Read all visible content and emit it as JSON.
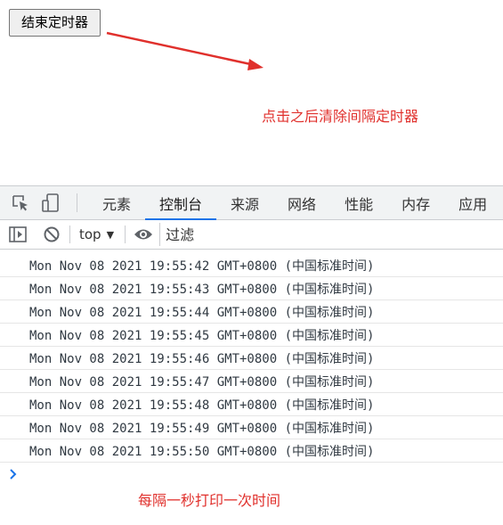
{
  "page": {
    "end_timer_button": "结束定时器",
    "annotation_top": "点击之后清除间隔定时器",
    "annotation_bottom": "每隔一秒打印一次时间",
    "annotation_color": "#e0302c"
  },
  "devtools": {
    "icons": [
      "inspect-element-icon",
      "device-toolbar-icon"
    ],
    "tabs": [
      {
        "label": "元素",
        "active": false
      },
      {
        "label": "控制台",
        "active": true
      },
      {
        "label": "来源",
        "active": false
      },
      {
        "label": "网络",
        "active": false
      },
      {
        "label": "性能",
        "active": false
      },
      {
        "label": "内存",
        "active": false
      },
      {
        "label": "应用",
        "active": false
      }
    ],
    "toolbar": {
      "context": "top",
      "filter_placeholder": "过滤"
    },
    "accent": "#1a73e8"
  },
  "console": {
    "logs": [
      "Mon Nov 08 2021 19:55:42 GMT+0800 (中国标准时间)",
      "Mon Nov 08 2021 19:55:43 GMT+0800 (中国标准时间)",
      "Mon Nov 08 2021 19:55:44 GMT+0800 (中国标准时间)",
      "Mon Nov 08 2021 19:55:45 GMT+0800 (中国标准时间)",
      "Mon Nov 08 2021 19:55:46 GMT+0800 (中国标准时间)",
      "Mon Nov 08 2021 19:55:47 GMT+0800 (中国标准时间)",
      "Mon Nov 08 2021 19:55:48 GMT+0800 (中国标准时间)",
      "Mon Nov 08 2021 19:55:49 GMT+0800 (中国标准时间)",
      "Mon Nov 08 2021 19:55:50 GMT+0800 (中国标准时间)"
    ],
    "prompt": "›"
  }
}
